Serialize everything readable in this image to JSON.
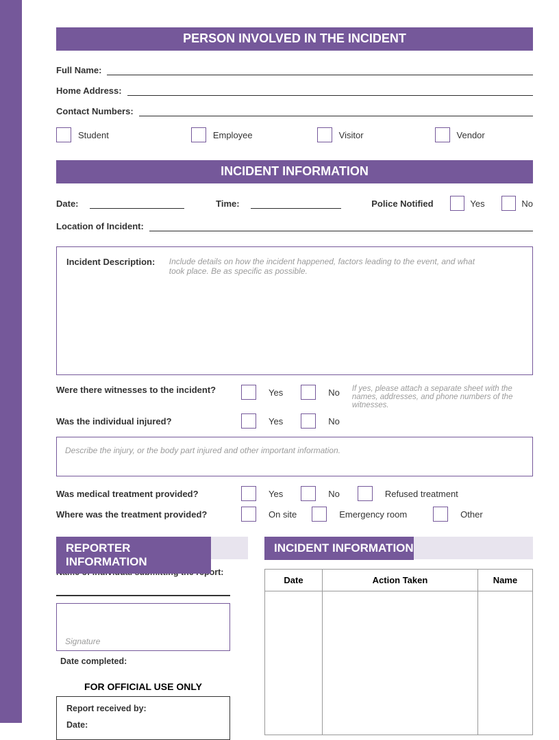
{
  "sections": {
    "person": "PERSON INVOLVED IN THE INCIDENT",
    "incident": "INCIDENT INFORMATION",
    "reporter": "REPORTER INFORMATION",
    "incident2": "INCIDENT INFORMATION"
  },
  "person": {
    "full_name": "Full Name:",
    "home_address": "Home Address:",
    "contact_numbers": "Contact Numbers:",
    "roles": {
      "student": "Student",
      "employee": "Employee",
      "visitor": "Visitor",
      "vendor": "Vendor"
    }
  },
  "incident": {
    "date": "Date:",
    "time": "Time:",
    "police": "Police Notified",
    "yes": "Yes",
    "no": "No",
    "location": "Location of Incident:",
    "desc_label": "Incident Description:",
    "desc_hint": "Include details on how the incident happened, factors leading to the event, and what took place. Be as specific as possible.",
    "witnesses_q": "Were there witnesses to the incident?",
    "witness_hint": "If yes, please attach a separate sheet with the names, addresses, and phone numbers of the witnesses.",
    "injured_q": "Was the individual injured?",
    "injury_hint": "Describe the injury, or the body part injured and other important information.",
    "medical_q": "Was medical treatment provided?",
    "refused": "Refused treatment",
    "where_q": "Where was the treatment provided?",
    "onsite": "On site",
    "er": "Emergency room",
    "other": "Other"
  },
  "reporter": {
    "name_label": "Name of Individual submitting the report:",
    "signature": "Signature",
    "date_completed": "Date completed:",
    "official_header": "FOR OFFICIAL USE ONLY",
    "received_by": "Report received by:",
    "date": "Date:"
  },
  "table": {
    "date": "Date",
    "action": "Action Taken",
    "name": "Name"
  }
}
